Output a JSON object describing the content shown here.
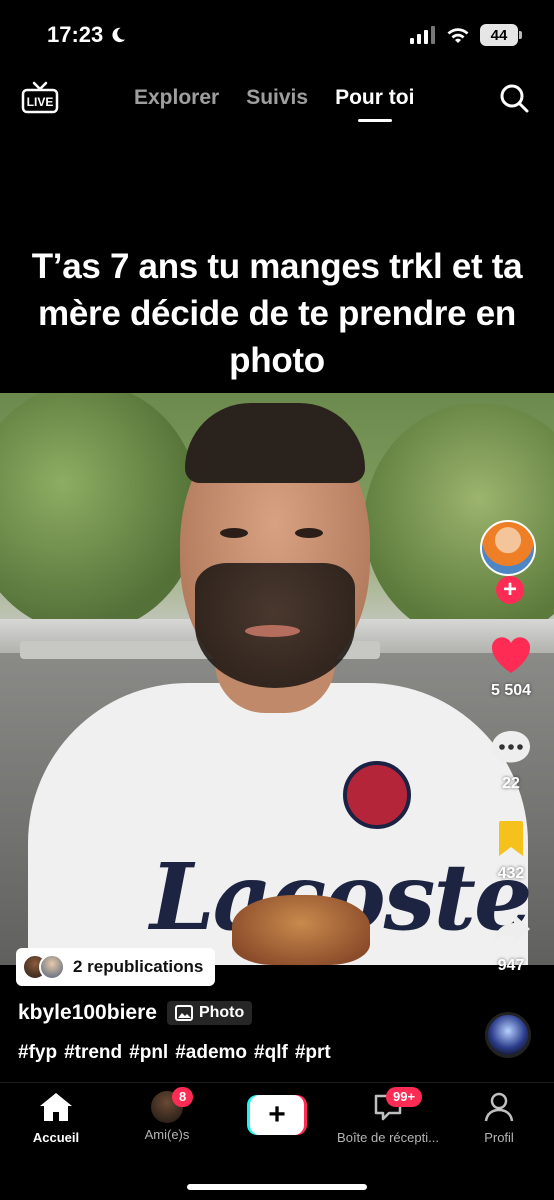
{
  "status_bar": {
    "time": "17:23",
    "battery": "44"
  },
  "top_nav": {
    "live_label": "LIVE",
    "tabs": [
      {
        "label": "Explorer",
        "active": false
      },
      {
        "label": "Suivis",
        "active": false
      },
      {
        "label": "Pour toi",
        "active": true
      }
    ]
  },
  "post": {
    "caption": "T’as 7 ans tu manges trkl et ta mère décide de te prendre en photo",
    "likes": "5 504",
    "comments": "22",
    "saves": "432",
    "shares": "947",
    "republications": "2 republications",
    "author": "kbyle100biere",
    "media_type": "Photo",
    "hashtags": [
      "#fyp",
      "#trend",
      "#pnl",
      "#ademo",
      "#qlf",
      "#prt"
    ]
  },
  "bottom_nav": {
    "items": [
      {
        "label": "Accueil",
        "active": true
      },
      {
        "label": "Ami(e)s",
        "badge": "8"
      },
      {
        "label": "",
        "create": true
      },
      {
        "label": "Boîte de récepti...",
        "badge": "99+"
      },
      {
        "label": "Profil"
      }
    ]
  },
  "colors": {
    "accent": "#fe2c55",
    "save": "#f4c21a",
    "cyan": "#25f4ee"
  }
}
